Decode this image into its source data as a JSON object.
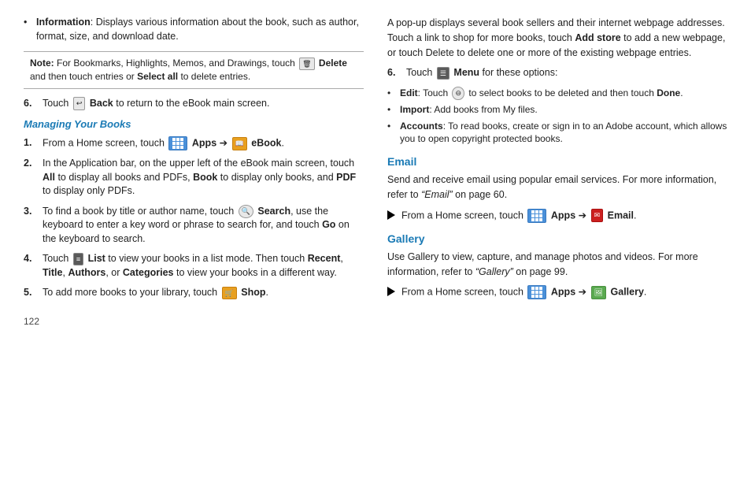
{
  "page": {
    "number": "122",
    "left": {
      "bullet_info": {
        "label": "Information",
        "text": ": Displays various information about the book, such as author, format, size, and download date."
      },
      "note": {
        "prefix": "Note:",
        "text": " For Bookmarks, Highlights, Memos, and Drawings, touch ",
        "delete_label": "Delete",
        "text2": " and then touch entries or ",
        "select_all": "Select all",
        "text3": " to delete entries."
      },
      "step6": {
        "num": "6.",
        "text1": "Touch ",
        "back_label": "Back",
        "text2": " to return to the eBook main screen."
      },
      "section_heading": "Managing Your Books",
      "step1": {
        "num": "1.",
        "text1": "From a Home screen, touch ",
        "apps_label": "Apps",
        "arrow": "➔",
        "ebook_label": "eBook",
        "text2": "."
      },
      "step2": {
        "num": "2.",
        "text": "In the Application bar, on the upper left of the eBook main screen, touch ",
        "all": "All",
        "text2": " to display all books and PDFs, ",
        "book": "Book",
        "text3": " to display only books, and ",
        "pdf": "PDF",
        "text4": " to display only PDFs."
      },
      "step3": {
        "num": "3.",
        "text1": "To find a book by title or author name, touch ",
        "search_label": "Search",
        "text2": ", use the keyboard to enter a key word or phrase to search for, and touch ",
        "go": "Go",
        "text3": " on the keyboard to search."
      },
      "step4": {
        "num": "4.",
        "text1": "Touch ",
        "list_label": "List",
        "text2": " to view your books in a list mode. Then touch ",
        "recent": "Recent",
        "comma1": ", ",
        "title": "Title",
        "comma2": ", ",
        "authors": "Authors",
        "comma3": ", or ",
        "categories": "Categories",
        "text3": " to view your books in a different way."
      },
      "step5": {
        "num": "5.",
        "text1": "To add more books to your library, touch ",
        "shop_label": "Shop",
        "text2": "."
      }
    },
    "right": {
      "para1": "A pop-up displays several book sellers and their internet webpage addresses. Touch a link to shop for more books, touch ",
      "add_store": "Add store",
      "para1b": " to add a new webpage, or touch Delete to delete one or more of the existing webpage entries.",
      "step6": {
        "num": "6.",
        "text1": "Touch ",
        "menu_label": "Menu",
        "text2": " for these options:"
      },
      "sub_bullets": [
        {
          "label": "Edit",
          "text": ": Touch ",
          "action": "to select books to be deleted and then touch ",
          "done": "Done",
          "text2": "."
        },
        {
          "label": "Import",
          "text": ": Add books from My files."
        },
        {
          "label": "Accounts",
          "text": ": To read books, create or sign in to an Adobe account, which allows you to open copyright protected books."
        }
      ],
      "email_section": {
        "title": "Email",
        "para": "Send and receive email using popular email services. For more information, refer to ",
        "ref": "“Email”",
        "para2": " on page 60.",
        "arrow_row": {
          "text1": "From a Home screen, touch ",
          "apps_label": "Apps",
          "arrow": "➔",
          "email_label": "Email",
          "text2": "."
        }
      },
      "gallery_section": {
        "title": "Gallery",
        "para": "Use Gallery to view, capture, and manage photos and videos. For more information, refer to ",
        "ref": "“Gallery”",
        "para2": " on page 99.",
        "arrow_row": {
          "text1": "From a Home screen, touch ",
          "apps_label": "Apps",
          "arrow": "➔",
          "gallery_label": "Gallery",
          "text2": "."
        }
      }
    }
  }
}
